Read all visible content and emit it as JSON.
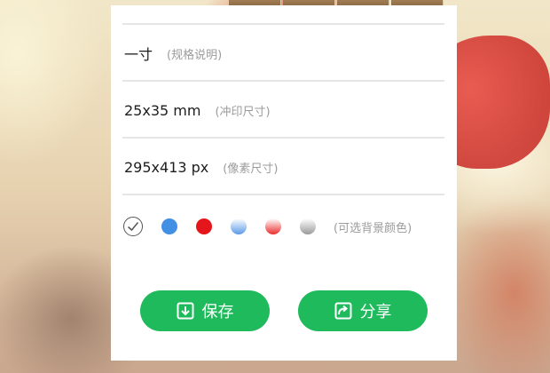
{
  "spec": {
    "name": "一寸",
    "name_note": "(规格说明)",
    "print_size": "25x35 mm",
    "print_size_note": "(冲印尺寸)",
    "pixel_size": "295x413 px",
    "pixel_size_note": "(像素尺寸)"
  },
  "background_colors": {
    "note": "(可选背景颜色)",
    "selected": "white",
    "options": [
      {
        "name": "white",
        "fill": "#ffffff"
      },
      {
        "name": "blue",
        "fill": "#438fe3"
      },
      {
        "name": "red",
        "fill": "#e5161b"
      },
      {
        "name": "blue-gradient",
        "fill": "#5c9ae6"
      },
      {
        "name": "red-gradient",
        "fill": "#ea2d2d"
      },
      {
        "name": "gray-gradient",
        "fill": "#9a9a9a"
      }
    ]
  },
  "actions": {
    "save_label": "保存",
    "share_label": "分享"
  },
  "colors": {
    "accent": "#1fba5c",
    "divider": "#e5e5e5",
    "note_text": "#9b9b9b"
  },
  "icons": {
    "save": "download-icon",
    "share": "share-icon",
    "selected": "check-icon"
  }
}
